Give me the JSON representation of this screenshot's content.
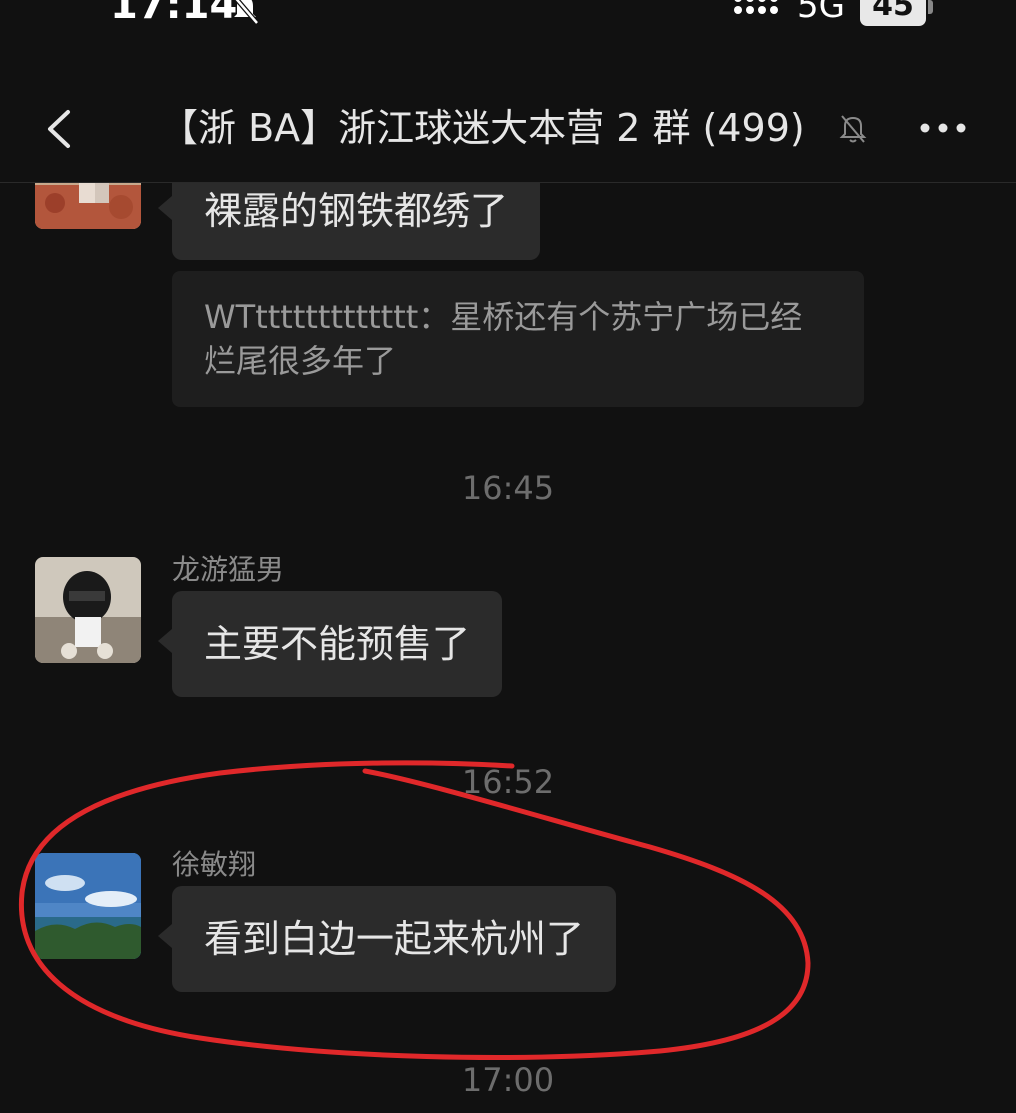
{
  "status_bar": {
    "time": "17:14",
    "network": "5G",
    "battery": "45"
  },
  "header": {
    "back_icon": "chevron-left-icon",
    "title": "【浙 BA】浙江球迷大本营 2 群 (499)",
    "mute_icon": "bell-off-icon",
    "more_icon": "ellipsis-icon"
  },
  "messages": [
    {
      "text": "裸露的钢铁都绣了",
      "quote": "WTttttttttttttt：星桥还有个苏宁广场已经烂尾很多年了"
    },
    {
      "timestamp": "16:45",
      "sender": "龙游猛男",
      "text": "主要不能预售了"
    },
    {
      "timestamp": "16:52",
      "sender": "徐敏翔",
      "text": "看到白边一起来杭州了"
    },
    {
      "timestamp": "17:00"
    }
  ],
  "colors": {
    "background": "#111111",
    "bubble": "#2b2b2b",
    "quote": "#1e1e1e",
    "annotation": "#e0282a"
  }
}
